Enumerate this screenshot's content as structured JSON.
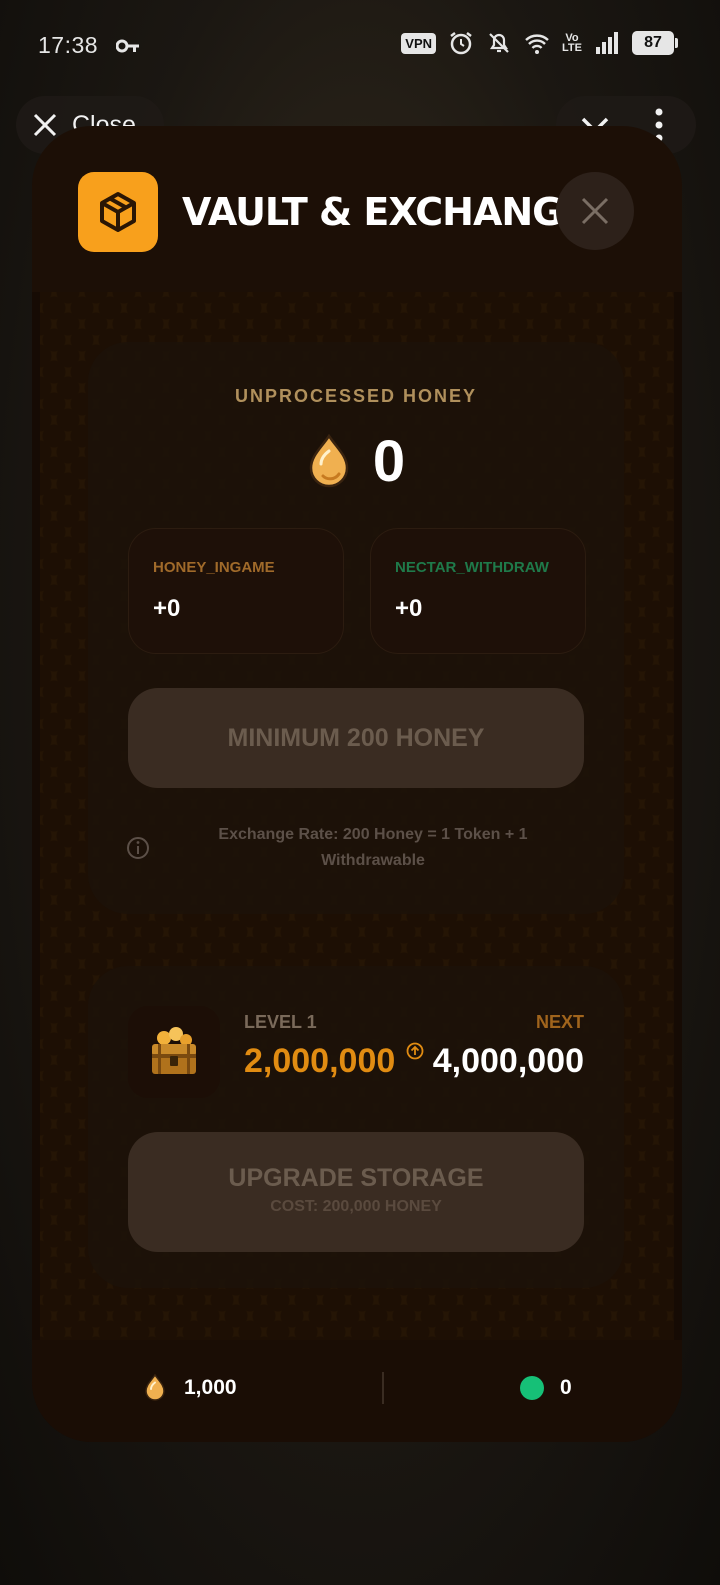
{
  "status_bar": {
    "time": "17:38",
    "vpn": "VPN",
    "volte_top": "Vo",
    "volte_bottom": "LTE",
    "battery": "87"
  },
  "top_bar": {
    "close_label": "Close"
  },
  "modal": {
    "title": "VAULT & EXCHANGE",
    "exchange": {
      "label": "UNPROCESSED HONEY",
      "value": "0",
      "honey_ingame_label": "HONEY_INGAME",
      "honey_ingame_value": "+0",
      "nectar_withdraw_label": "NECTAR_WITHDRAW",
      "nectar_withdraw_value": "+0",
      "button_label": "MINIMUM 200 HONEY",
      "rate_text": "Exchange Rate: 200 Honey = 1 Token + 1 Withdrawable"
    },
    "storage": {
      "level_label": "LEVEL 1",
      "next_label": "NEXT",
      "current_capacity": "2,000,000",
      "next_capacity": "4,000,000",
      "upgrade_label": "UPGRADE STORAGE",
      "upgrade_cost": "COST: 200,000 HONEY"
    },
    "footer": {
      "honey_balance": "1,000",
      "nectar_balance": "0"
    }
  },
  "colors": {
    "accent_orange": "#f8a01c",
    "capacity_orange": "#e18c12",
    "nectar_green": "#16c077",
    "modal_bg": "#1c0f06"
  }
}
